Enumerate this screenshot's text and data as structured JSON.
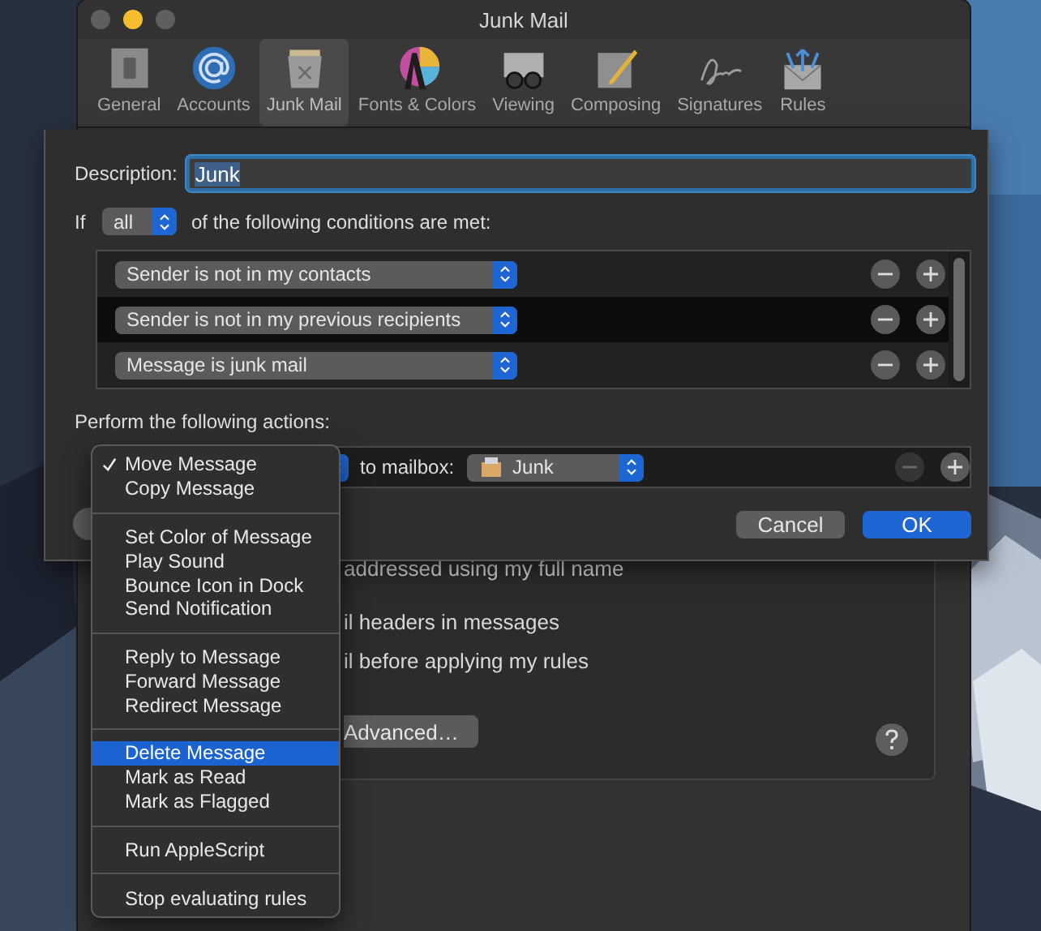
{
  "window": {
    "title": "Junk Mail",
    "toolbar": [
      {
        "label": "General",
        "selected": false
      },
      {
        "label": "Accounts",
        "selected": false
      },
      {
        "label": "Junk Mail",
        "selected": true
      },
      {
        "label": "Fonts & Colors",
        "selected": false
      },
      {
        "label": "Viewing",
        "selected": false
      },
      {
        "label": "Composing",
        "selected": false
      },
      {
        "label": "Signatures",
        "selected": false
      },
      {
        "label": "Rules",
        "selected": false
      }
    ],
    "options": [
      "addressed using my full name",
      "il headers in messages",
      "il before applying my rules"
    ],
    "advanced_button": "Advanced…"
  },
  "sheet": {
    "description_label": "Description:",
    "description_value": "Junk",
    "if_label": "If",
    "match": "all",
    "conditions_label": "of the following conditions are met:",
    "conditions": [
      {
        "label": "Sender is not in my contacts"
      },
      {
        "label": "Sender is not in my previous recipients"
      },
      {
        "label": "Message is junk mail"
      }
    ],
    "actions_label": "Perform the following actions:",
    "action": {
      "mailbox_label": "to mailbox:",
      "mailbox": "Junk",
      "remove_disabled": true
    },
    "buttons": [
      {
        "label": "Cancel",
        "default": false
      },
      {
        "label": "OK",
        "default": true
      }
    ]
  },
  "menu": {
    "groups": [
      [
        {
          "label": "Move Message",
          "checked": true,
          "selected": false
        },
        {
          "label": "Copy Message",
          "checked": false,
          "selected": false
        }
      ],
      [
        {
          "label": "Set Color of Message",
          "checked": false,
          "selected": false
        },
        {
          "label": "Play Sound",
          "checked": false,
          "selected": false
        },
        {
          "label": "Bounce Icon in Dock",
          "checked": false,
          "selected": false
        },
        {
          "label": "Send Notification",
          "checked": false,
          "selected": false
        }
      ],
      [
        {
          "label": "Reply to Message",
          "checked": false,
          "selected": false
        },
        {
          "label": "Forward Message",
          "checked": false,
          "selected": false
        },
        {
          "label": "Redirect Message",
          "checked": false,
          "selected": false
        }
      ],
      [
        {
          "label": "Delete Message",
          "checked": false,
          "selected": true
        },
        {
          "label": "Mark as Read",
          "checked": false,
          "selected": false
        },
        {
          "label": "Mark as Flagged",
          "checked": false,
          "selected": false
        }
      ],
      [
        {
          "label": "Run AppleScript",
          "checked": false,
          "selected": false
        }
      ],
      [
        {
          "label": "Stop evaluating rules",
          "checked": false,
          "selected": false
        }
      ]
    ]
  }
}
